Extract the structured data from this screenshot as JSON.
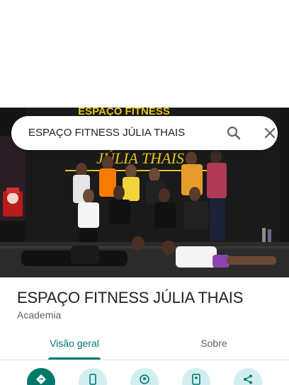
{
  "search": {
    "query": "ESPAÇO FITNESS JÚLIA THAIS"
  },
  "hero_photo": {
    "sign_lines": [
      "ESPAÇO FITNESS",
      "JÚLIA THAIS"
    ]
  },
  "place": {
    "name": "ESPAÇO FITNESS JÚLIA THAIS",
    "category": "Academia"
  },
  "tabs": [
    {
      "label": "Visão geral",
      "selected": true
    },
    {
      "label": "Sobre",
      "selected": false
    }
  ],
  "actions": [
    {
      "icon": "directions-icon"
    },
    {
      "icon": "phone-icon"
    },
    {
      "icon": "nearby-icon"
    },
    {
      "icon": "save-icon"
    },
    {
      "icon": "share-icon"
    }
  ],
  "colors": {
    "accent": "#00796b",
    "action_bg": "#d3eef0",
    "sign_yellow": "#e8c21a"
  }
}
